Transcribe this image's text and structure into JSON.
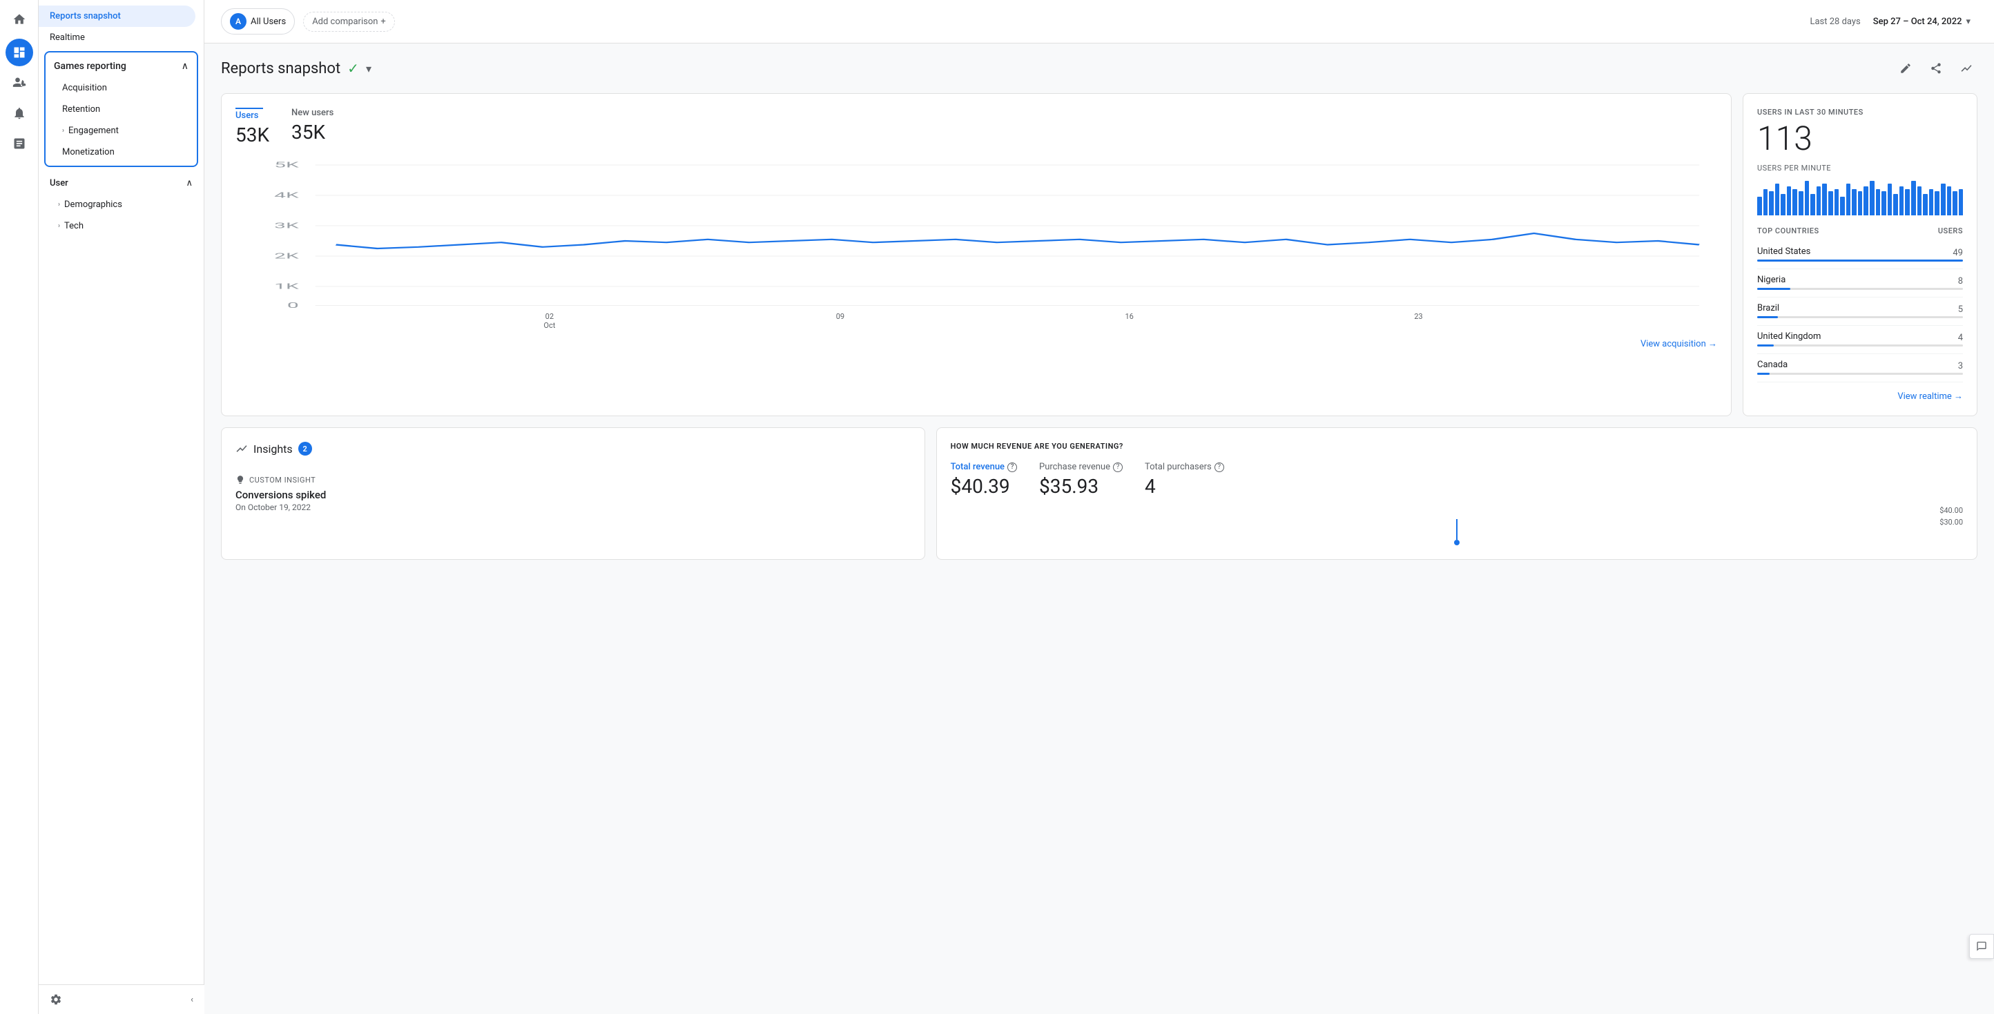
{
  "sidebar": {
    "reports_snapshot": "Reports snapshot",
    "realtime": "Realtime",
    "games_reporting": "Games reporting",
    "acquisition": "Acquisition",
    "retention": "Retention",
    "engagement": "Engagement",
    "monetization": "Monetization",
    "user": "User",
    "demographics": "Demographics",
    "tech": "Tech",
    "settings": "⚙"
  },
  "header": {
    "user_label": "All Users",
    "user_initial": "A",
    "add_comparison": "Add comparison",
    "last_days": "Last 28 days",
    "date_range": "Sep 27 – Oct 24, 2022"
  },
  "page": {
    "title": "Reports snapshot",
    "check_icon": "✓",
    "edit_icon": "✎",
    "share_icon": "↗",
    "insights_icon": "↗"
  },
  "main_chart": {
    "users_label": "Users",
    "users_value": "53K",
    "new_users_label": "New users",
    "new_users_value": "35K",
    "y_labels": [
      "5K",
      "4K",
      "3K",
      "2K",
      "1K",
      "0"
    ],
    "x_labels": [
      "",
      "02\nOct",
      "09",
      "16",
      "23",
      ""
    ],
    "view_link": "View acquisition →"
  },
  "realtime": {
    "title": "USERS IN LAST 30 MINUTES",
    "value": "113",
    "sub": "USERS PER MINUTE",
    "top_countries_label": "TOP COUNTRIES",
    "users_label": "USERS",
    "countries": [
      {
        "name": "United States",
        "value": 49,
        "pct": 100
      },
      {
        "name": "Nigeria",
        "value": 8,
        "pct": 16
      },
      {
        "name": "Brazil",
        "value": 5,
        "pct": 10
      },
      {
        "name": "United Kingdom",
        "value": 4,
        "pct": 8
      },
      {
        "name": "Canada",
        "value": 3,
        "pct": 6
      }
    ],
    "view_link": "View realtime →",
    "mini_bars": [
      35,
      50,
      45,
      60,
      40,
      55,
      50,
      45,
      65,
      40,
      55,
      60,
      45,
      50,
      35,
      60,
      50,
      45,
      55,
      65,
      50,
      45,
      60,
      40,
      55,
      50,
      65,
      55,
      40,
      50,
      45,
      60,
      55,
      45,
      50
    ]
  },
  "insights": {
    "title": "Insights",
    "badge": "2",
    "type": "CUSTOM INSIGHT",
    "text": "Conversions spiked",
    "date": "On October 19, 2022"
  },
  "revenue": {
    "question": "HOW MUCH REVENUE ARE YOU GENERATING?",
    "total_revenue_label": "Total revenue",
    "total_revenue_value": "$40.39",
    "purchase_revenue_label": "Purchase revenue",
    "purchase_revenue_value": "$35.93",
    "total_purchasers_label": "Total purchasers",
    "total_purchasers_value": "4",
    "chart_max": "$40.00",
    "chart_mid": "$30.00"
  },
  "icons": {
    "home": "⌂",
    "dashboard": "▦",
    "users": "👤",
    "search": "🔍",
    "reports": "☰",
    "settings": "⚙",
    "collapse": "‹",
    "expand_up": "∧",
    "chevron_right": "›",
    "chevron_down": "∨",
    "plus": "+",
    "calendar": "📅",
    "feedback": "💬"
  }
}
